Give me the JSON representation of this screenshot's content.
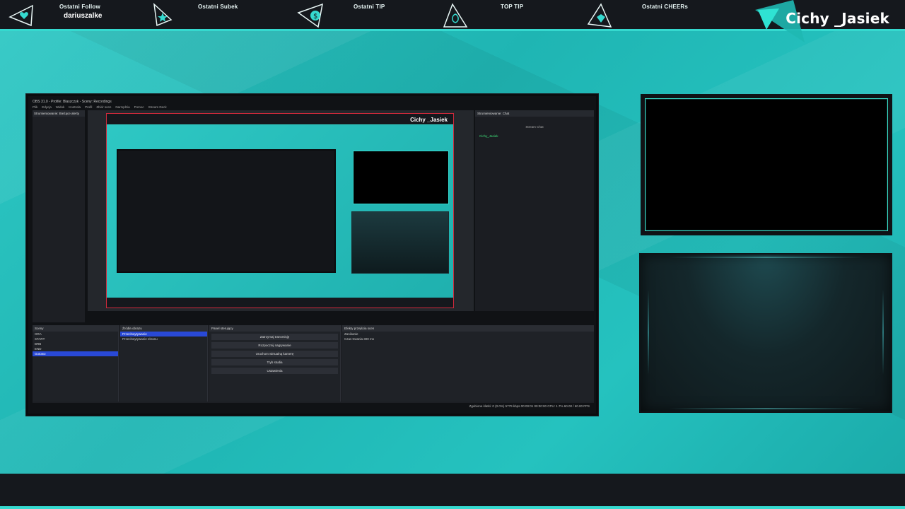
{
  "topbar": {
    "alerts": [
      {
        "title": "Ostatni Follow",
        "value": "dariuszalke",
        "icon": "heart-icon"
      },
      {
        "title": "Ostatni Subek",
        "value": "",
        "icon": "star-icon"
      },
      {
        "title": "Ostatni TIP",
        "value": "",
        "icon": "dollar-icon"
      },
      {
        "title": "TOP TIP",
        "value": "",
        "icon": "money-bag-icon"
      },
      {
        "title": "Ostatni CHEERs",
        "value": "",
        "icon": "diamond-icon"
      }
    ],
    "channel_name": "Cichy _Jasiek"
  },
  "capture": {
    "window_title": "OBS 31.0 - Profile: Blaszczyk - Sceny: Recordings",
    "menu": [
      "Plik",
      "Edycja",
      "Widok",
      "Kontrola",
      "Profil",
      "Zbiór scen",
      "Narzędzia",
      "Pomoc",
      "Stream Deck"
    ],
    "left_dock_title": "Strumieniowanie: Bieżące alerty",
    "preview_channel_name": "Cichy _Jasiek",
    "chat_title": "Strumieniowanie: Chat",
    "chat_center": "Stream Chat",
    "chat_user": "Cichy_Jasiek",
    "scenes": {
      "title": "Sceny",
      "items": [
        "GRA",
        "START",
        "BRB",
        "END",
        "Gotowo"
      ]
    },
    "sources": {
      "title": "Źródła obrazu",
      "items": [
        "Przechwytywanie",
        "Przechwytywanie ekranu"
      ]
    },
    "controls": {
      "title": "Panel sterujący",
      "buttons": [
        "Zatrzymaj transmisję",
        "Rozpocznij nagrywanie",
        "Uruchom wirtualną kamerę",
        "Tryb studia",
        "Ustawienia"
      ]
    },
    "transitions": {
      "title": "Efekty przejścia scen",
      "value": "Zanikanie",
      "duration_label": "Czas trwania",
      "duration": "300 ms"
    },
    "status": "Zgubione klatki: 0 (0.0%)   5779 kbps   00:00:01   00:00:00   CPU: 1.7%   60.00 / 60.00 FPS"
  },
  "colors": {
    "accent": "#35d9cf",
    "bar": "#15181d",
    "selection": "#2949d6",
    "preview_border": "#d02a3c"
  }
}
